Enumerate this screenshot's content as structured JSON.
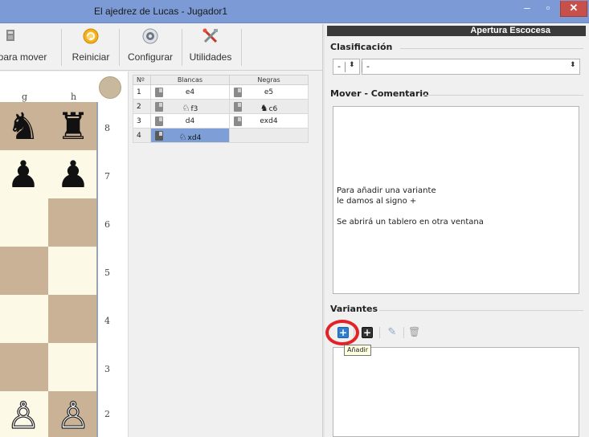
{
  "window": {
    "title": "El ajedrez de Lucas - Jugador1",
    "minimize_label": "–",
    "maximize_label": "▫",
    "close_label": "✕"
  },
  "toolbar": {
    "items": [
      {
        "label": "para mover",
        "icon": "cursor-icon"
      },
      {
        "label": "Reiniciar",
        "icon": "refresh-icon"
      },
      {
        "label": "Configurar",
        "icon": "gear-icon"
      },
      {
        "label": "Utilidades",
        "icon": "tools-icon"
      }
    ]
  },
  "board": {
    "files": [
      "g",
      "h"
    ],
    "ranks": [
      "8",
      "7",
      "6",
      "5",
      "4",
      "3",
      "2"
    ],
    "pieces": {
      "black_knight": "♞",
      "black_rook": "♜",
      "black_pawn": "♟",
      "white_pawn": "♙"
    }
  },
  "moves": {
    "headers": {
      "num": "Nº",
      "white": "Blancas",
      "black": "Negras"
    },
    "rows": [
      {
        "num": "1",
        "white": "e4",
        "black": "e5"
      },
      {
        "num": "2",
        "white_fig": "♘",
        "white": "f3",
        "black_fig": "♞",
        "black": "c6"
      },
      {
        "num": "3",
        "white": "d4",
        "black": "exd4"
      },
      {
        "num": "4",
        "white_fig": "♘",
        "white": "xd4",
        "black": ""
      }
    ]
  },
  "panel": {
    "opening_title": "Apertura Escocesa",
    "classification_label": "Clasificación",
    "combo_left_value": "-",
    "combo_right_value": "-",
    "combo_arrow": "⬍",
    "comment_label": "Mover - Comentario",
    "comment_text": "Para añadir una variante\nle damos al signo +\n\nSe abrirá un tablero en otra ventana",
    "variants_label": "Variantes",
    "add_tooltip": "Añadir",
    "add_symbol": "+",
    "edit_symbol": "✎",
    "delete_symbol": "🗑"
  }
}
